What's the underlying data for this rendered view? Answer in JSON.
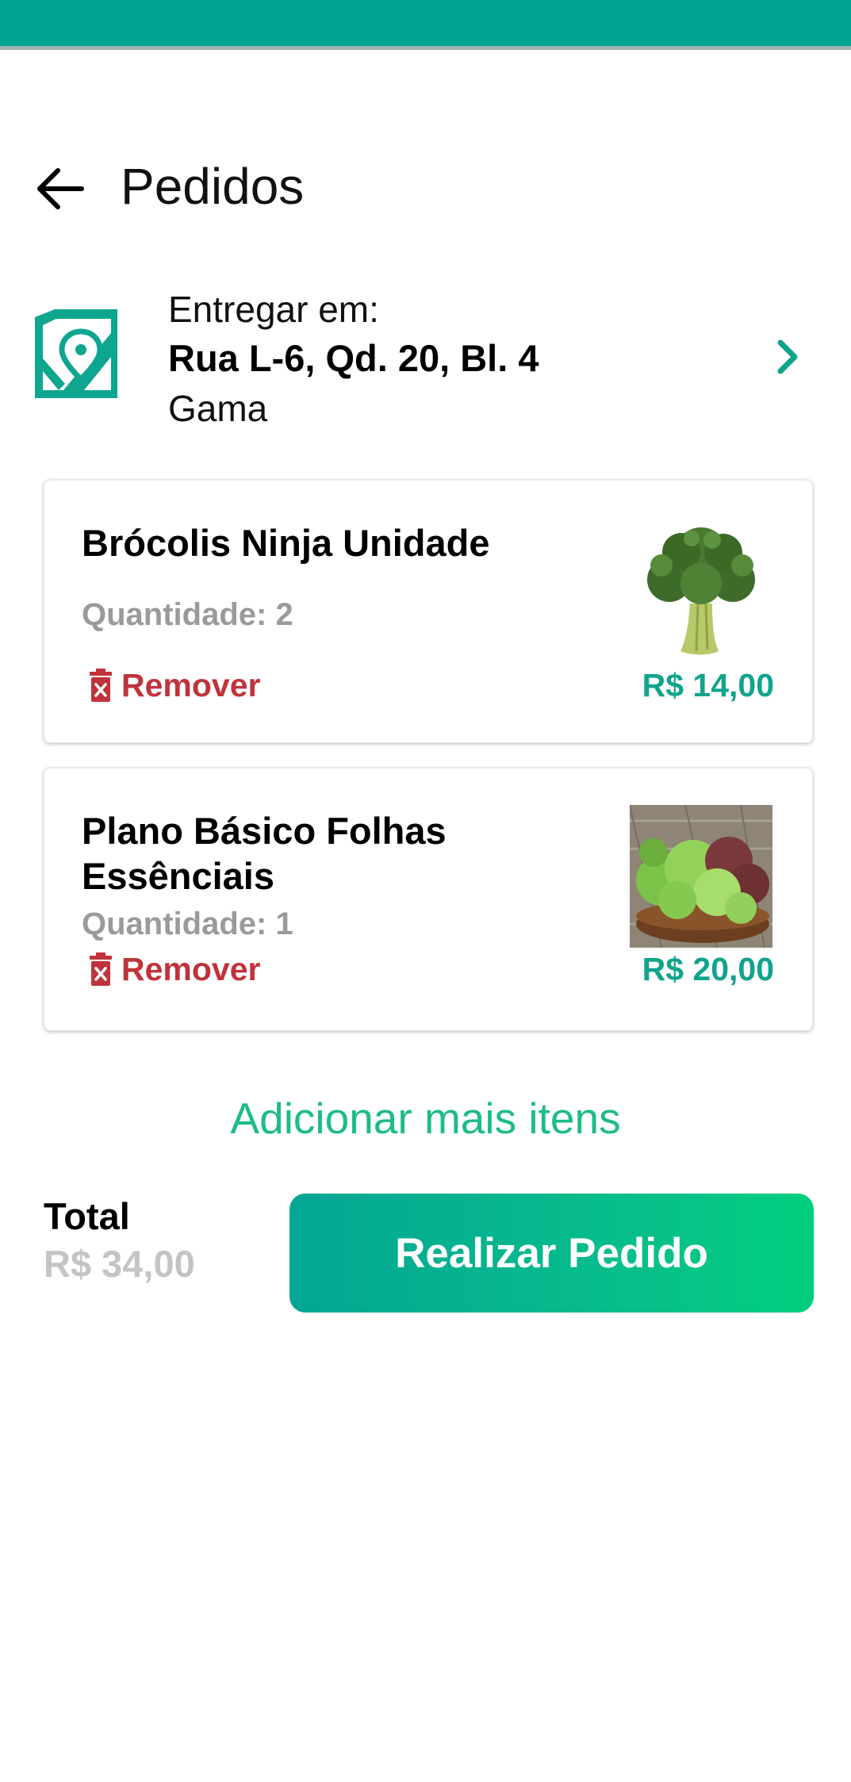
{
  "header": {
    "title": "Pedidos"
  },
  "address": {
    "label": "Entregar em:",
    "street": "Rua L-6, Qd. 20, Bl. 4",
    "city": "Gama"
  },
  "items": [
    {
      "name": "Brócolis Ninja Unidade",
      "quantity": "Quantidade: 2",
      "remove_label": "Remover",
      "price": "R$ 14,00",
      "image": "broccoli-image"
    },
    {
      "name": "Plano Básico Folhas Essênciais",
      "quantity": "Quantidade: 1",
      "remove_label": "Remover",
      "price": "R$ 20,00",
      "image": "leafy-greens-bowl-image"
    }
  ],
  "add_more": "Adicionar mais itens",
  "footer": {
    "total_label": "Total",
    "total_value": "R$ 34,00",
    "order_button": "Realizar Pedido"
  },
  "colors": {
    "status_bar": "#00a591",
    "accent": "#11a48c",
    "remove": "#c0333a",
    "button_gradient_start": "#03a693",
    "button_gradient_end": "#00cf7e"
  },
  "icons": [
    "back-arrow-icon",
    "map-pin-icon",
    "chevron-right-icon",
    "trash-icon"
  ]
}
